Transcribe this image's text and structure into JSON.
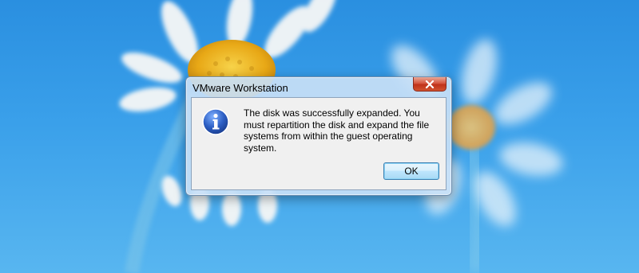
{
  "window": {
    "title": "VMware Workstation",
    "close_icon": "close-icon"
  },
  "dialog": {
    "icon": "info-icon",
    "message": "The disk was successfully expanded. You must repartition the disk and expand the file systems from within the guest operating system.",
    "ok_label": "OK"
  },
  "colors": {
    "desktop_blue": "#2a8fe0",
    "close_red": "#c0321a",
    "info_blue": "#2d5fc4"
  }
}
